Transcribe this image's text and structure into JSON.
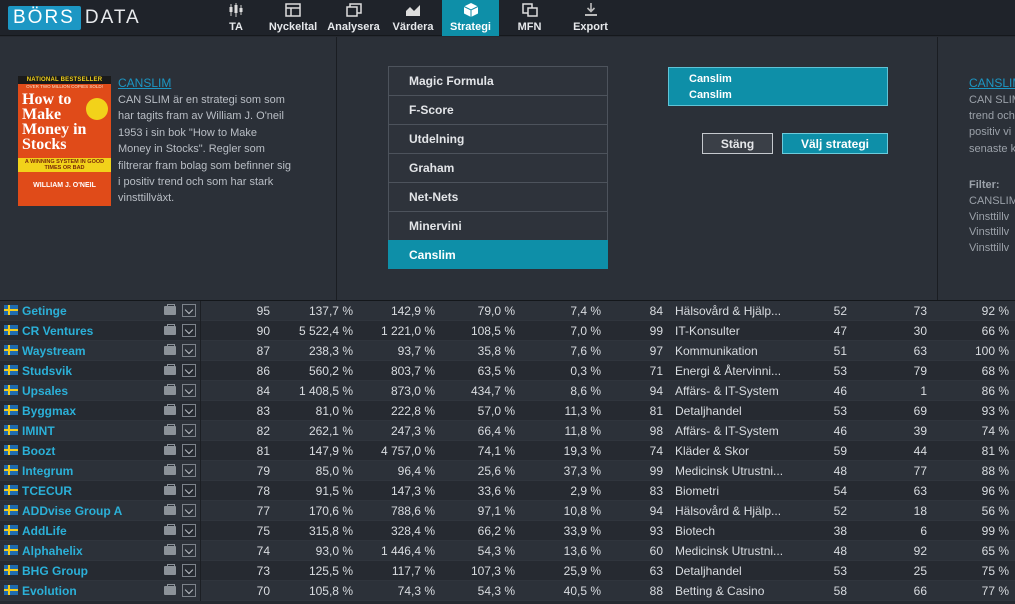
{
  "logo": {
    "box": "BÖRS",
    "rest": "DATA"
  },
  "nav": [
    {
      "label": "TA",
      "icon": "candlestick-icon"
    },
    {
      "label": "Nyckeltal",
      "icon": "key-figures-icon"
    },
    {
      "label": "Analysera",
      "icon": "analyze-icon"
    },
    {
      "label": "Värdera",
      "icon": "area-chart-icon"
    },
    {
      "label": "Strategi",
      "icon": "cube-icon"
    },
    {
      "label": "MFN",
      "icon": "mfn-icon"
    },
    {
      "label": "Export",
      "icon": "download-icon"
    }
  ],
  "strategy_info": {
    "link": "CANSLIM",
    "text": "CAN SLIM är en strategi som som har tagits fram av William J. O'neil 1953 i sin bok \"How to Make Money in Stocks\". Regler som filtrerar fram bolag som befinner sig i positiv trend och som har stark vinsttillväxt.",
    "book": {
      "banner": "NATIONAL BESTSELLER",
      "sub": "OVER TWO MILLION COPIES SOLD!",
      "title": "How to Make Money in Stocks",
      "stripe": "A WINNING SYSTEM IN GOOD TIMES OR BAD",
      "author": "WILLIAM J. O'NEIL"
    }
  },
  "strategies": [
    "Magic Formula",
    "F-Score",
    "Utdelning",
    "Graham",
    "Net-Nets",
    "Minervini",
    "Canslim"
  ],
  "selected": {
    "line1": "Canslim",
    "line2": "Canslim"
  },
  "buttons": {
    "close": "Stäng",
    "choose": "Välj strategi"
  },
  "right_info": {
    "link": "CANSLIM",
    "text": [
      "CAN SLIM",
      "trend och",
      "positiv vi",
      "senaste k"
    ],
    "filter_label": "Filter:",
    "filters": [
      "CANSLIM",
      "Vinsttillv",
      "Vinsttillv",
      "Vinsttillv"
    ]
  },
  "rows": [
    {
      "name": "Getinge",
      "score": "95",
      "v1": "137,7 %",
      "v2": "142,9 %",
      "v3": "79,0 %",
      "v4": "7,4 %",
      "rank": "84",
      "sector": "Hälsovård & Hjälp...",
      "n1": "52",
      "n2": "73",
      "pct": "92 %"
    },
    {
      "name": "CR Ventures",
      "score": "90",
      "v1": "5 522,4 %",
      "v2": "1 221,0 %",
      "v3": "108,5 %",
      "v4": "7,0 %",
      "rank": "99",
      "sector": "IT-Konsulter",
      "n1": "47",
      "n2": "30",
      "pct": "66 %"
    },
    {
      "name": "Waystream",
      "score": "87",
      "v1": "238,3 %",
      "v2": "93,7 %",
      "v3": "35,8 %",
      "v4": "7,6 %",
      "rank": "97",
      "sector": "Kommunikation",
      "n1": "51",
      "n2": "63",
      "pct": "100 %"
    },
    {
      "name": "Studsvik",
      "score": "86",
      "v1": "560,2 %",
      "v2": "803,7 %",
      "v3": "63,5 %",
      "v4": "0,3 %",
      "rank": "71",
      "sector": "Energi & Återvinni...",
      "n1": "53",
      "n2": "79",
      "pct": "68 %"
    },
    {
      "name": "Upsales",
      "score": "84",
      "v1": "1 408,5 %",
      "v2": "873,0 %",
      "v3": "434,7 %",
      "v4": "8,6 %",
      "rank": "94",
      "sector": "Affärs- & IT-System",
      "n1": "46",
      "n2": "1",
      "pct": "86 %"
    },
    {
      "name": "Byggmax",
      "score": "83",
      "v1": "81,0 %",
      "v2": "222,8 %",
      "v3": "57,0 %",
      "v4": "11,3 %",
      "rank": "81",
      "sector": "Detaljhandel",
      "n1": "53",
      "n2": "69",
      "pct": "93 %"
    },
    {
      "name": "IMINT",
      "score": "82",
      "v1": "262,1 %",
      "v2": "247,3 %",
      "v3": "66,4 %",
      "v4": "11,8 %",
      "rank": "98",
      "sector": "Affärs- & IT-System",
      "n1": "46",
      "n2": "39",
      "pct": "74 %"
    },
    {
      "name": "Boozt",
      "score": "81",
      "v1": "147,9 %",
      "v2": "4 757,0 %",
      "v3": "74,1 %",
      "v4": "19,3 %",
      "rank": "74",
      "sector": "Kläder & Skor",
      "n1": "59",
      "n2": "44",
      "pct": "81 %"
    },
    {
      "name": "Integrum",
      "score": "79",
      "v1": "85,0 %",
      "v2": "96,4 %",
      "v3": "25,6 %",
      "v4": "37,3 %",
      "rank": "99",
      "sector": "Medicinsk Utrustni...",
      "n1": "48",
      "n2": "77",
      "pct": "88 %"
    },
    {
      "name": "TCECUR",
      "score": "78",
      "v1": "91,5 %",
      "v2": "147,3 %",
      "v3": "33,6 %",
      "v4": "2,9 %",
      "rank": "83",
      "sector": "Biometri",
      "n1": "54",
      "n2": "63",
      "pct": "96 %"
    },
    {
      "name": "ADDvise Group A",
      "score": "77",
      "v1": "170,6 %",
      "v2": "788,6 %",
      "v3": "97,1 %",
      "v4": "10,8 %",
      "rank": "94",
      "sector": "Hälsovård & Hjälp...",
      "n1": "52",
      "n2": "18",
      "pct": "56 %"
    },
    {
      "name": "AddLife",
      "score": "75",
      "v1": "315,8 %",
      "v2": "328,4 %",
      "v3": "66,2 %",
      "v4": "33,9 %",
      "rank": "93",
      "sector": "Biotech",
      "n1": "38",
      "n2": "6",
      "pct": "99 %"
    },
    {
      "name": "Alphahelix",
      "score": "74",
      "v1": "93,0 %",
      "v2": "1 446,4 %",
      "v3": "54,3 %",
      "v4": "13,6 %",
      "rank": "60",
      "sector": "Medicinsk Utrustni...",
      "n1": "48",
      "n2": "92",
      "pct": "65 %"
    },
    {
      "name": "BHG Group",
      "score": "73",
      "v1": "125,5 %",
      "v2": "117,7 %",
      "v3": "107,3 %",
      "v4": "25,9 %",
      "rank": "63",
      "sector": "Detaljhandel",
      "n1": "53",
      "n2": "25",
      "pct": "75 %"
    },
    {
      "name": "Evolution",
      "score": "70",
      "v1": "105,8 %",
      "v2": "74,3 %",
      "v3": "54,3 %",
      "v4": "40,5 %",
      "rank": "88",
      "sector": "Betting & Casino",
      "n1": "58",
      "n2": "66",
      "pct": "77 %"
    }
  ]
}
